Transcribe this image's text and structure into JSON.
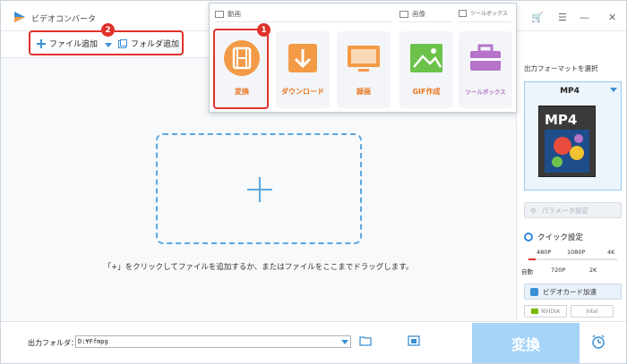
{
  "window": {
    "title": "ビデオコンバータ",
    "controls": {
      "cart": "🛒",
      "menu": "☰",
      "minimize": "—",
      "close": "✕"
    }
  },
  "toolbar": {
    "add_file_label": "ファイル追加",
    "add_folder_label": "フォルダ追加",
    "badge_2": "2"
  },
  "menu": {
    "section_video": "動画",
    "section_image": "画像",
    "section_toolbox": "ツールボックス",
    "badge_1": "1",
    "tiles": [
      {
        "label": "変換",
        "icon": "film-icon",
        "color": "#f39a46"
      },
      {
        "label": "ダウンロード",
        "icon": "download-icon",
        "color": "#f39a46"
      },
      {
        "label": "録画",
        "icon": "monitor-record-icon",
        "color": "#f39a46"
      },
      {
        "label": "GIF作成",
        "icon": "image-icon",
        "color": "#6cc24a"
      },
      {
        "label": "ツールボックス",
        "icon": "toolbox-icon",
        "color": "#b574c9"
      }
    ]
  },
  "main": {
    "hint": "「+」をクリックしてファイルを追加するか、またはファイルをここまでドラッグします。"
  },
  "right_panel": {
    "output_format_title": "出力フォーマットを選択",
    "format": "MP4",
    "format_badge": "MP4",
    "param_label": "パラメータ設定",
    "quick_label": "クイック設定",
    "quality_top": [
      "480P",
      "1080P",
      "4K"
    ],
    "quality_bottom": [
      "自動",
      "720P",
      "2K"
    ],
    "gpu_label": "ビデオカード加速",
    "nvidia": "NVIDIA",
    "intel": "Intel"
  },
  "bottom": {
    "output_folder_label": "出力フォルダ：",
    "output_path": "D:¥Ffmpg",
    "convert_label": "変換"
  },
  "colors": {
    "accent": "#3b8fd6",
    "orange": "#f39a46",
    "red": "#e0312b",
    "convert": "#a6d4f7"
  }
}
